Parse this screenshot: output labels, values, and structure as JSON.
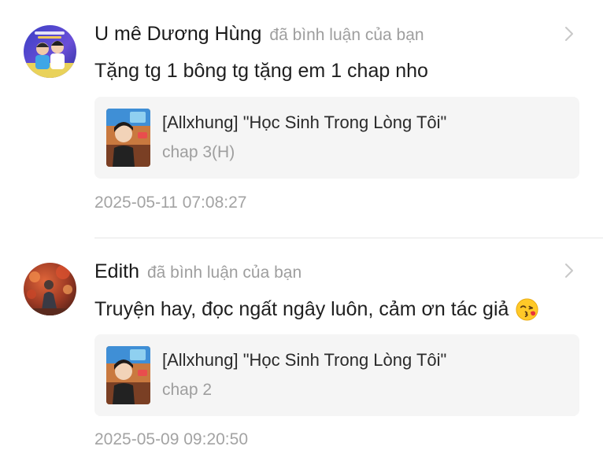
{
  "notifications": [
    {
      "avatar_icon": "user-avatar-two-boys",
      "username": "U mê Dương Hùng",
      "action": "đã bình luận của bạn",
      "comment": "Tặng tg 1 bông tg tặng em 1 chap nho",
      "emoji": "",
      "story_title": "[Allxhung] \"Học Sinh Trong Lòng Tôi\"",
      "chapter": "chap 3(H)",
      "timestamp": "2025-05-11 07:08:27"
    },
    {
      "avatar_icon": "user-avatar-autumn-person",
      "username": "Edith",
      "action": "đã bình luận của bạn",
      "comment": "Truyện hay, đọc ngất ngây luôn, cảm ơn tác giả",
      "emoji": "face-blowing-kiss",
      "story_title": "[Allxhung] \"Học Sinh Trong Lòng Tôi\"",
      "chapter": "chap 2",
      "timestamp": "2025-05-09 09:20:50"
    }
  ],
  "colors": {
    "muted_text": "#9e9e9e",
    "card_bg": "#f5f5f5",
    "divider": "#e6e6e6"
  }
}
